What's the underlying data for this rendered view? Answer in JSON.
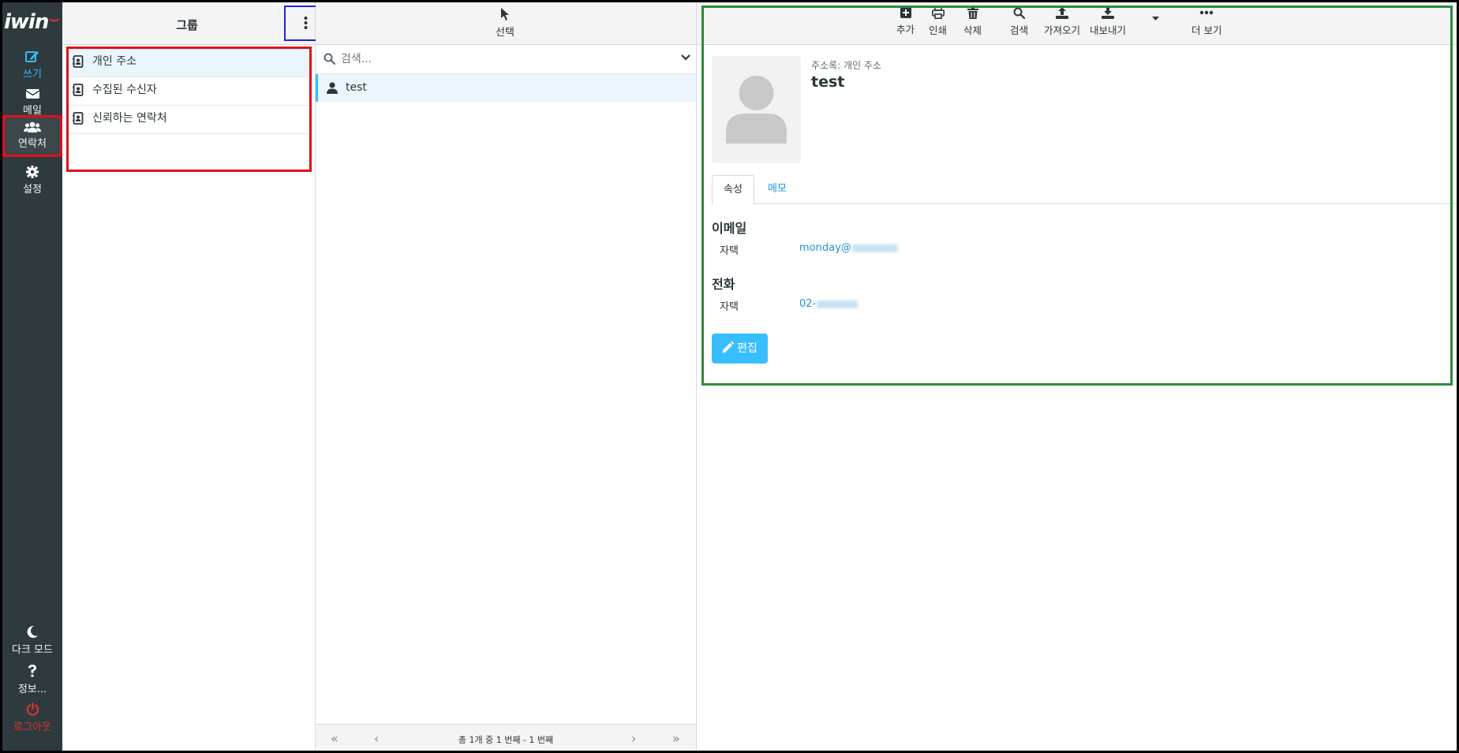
{
  "nav": {
    "logo": "iwin",
    "compose": "쓰기",
    "mail": "메일",
    "contacts": "연락처",
    "settings": "설정",
    "dark_mode": "다크 모드",
    "about": "정보...",
    "logout": "로그아웃"
  },
  "groups": {
    "title": "그룹",
    "items": [
      "개인 주소",
      "수집된 수신자",
      "신뢰하는 연락처"
    ]
  },
  "list": {
    "select_label": "선택",
    "search_placeholder": "검색...",
    "contacts": [
      "test"
    ],
    "pager_info": "총 1개 중 1 번째 - 1 번째"
  },
  "toolbar": {
    "add": "추가",
    "print": "인쇄",
    "delete": "삭제",
    "search": "검색",
    "import": "가져오기",
    "export": "내보내기",
    "more": "더 보기"
  },
  "detail": {
    "address_book_label": "주소록: 개인 주소",
    "name": "test",
    "tab_properties": "속성",
    "tab_notes": "메모",
    "email_section": "이메일",
    "email_type": "자택",
    "email_value": "monday@",
    "phone_section": "전화",
    "phone_type": "자택",
    "phone_value": "02-",
    "edit_button": "편집"
  },
  "colors": {
    "accent": "#37beff",
    "nav_bg": "#2f3a3f",
    "logout": "#e0312d"
  }
}
